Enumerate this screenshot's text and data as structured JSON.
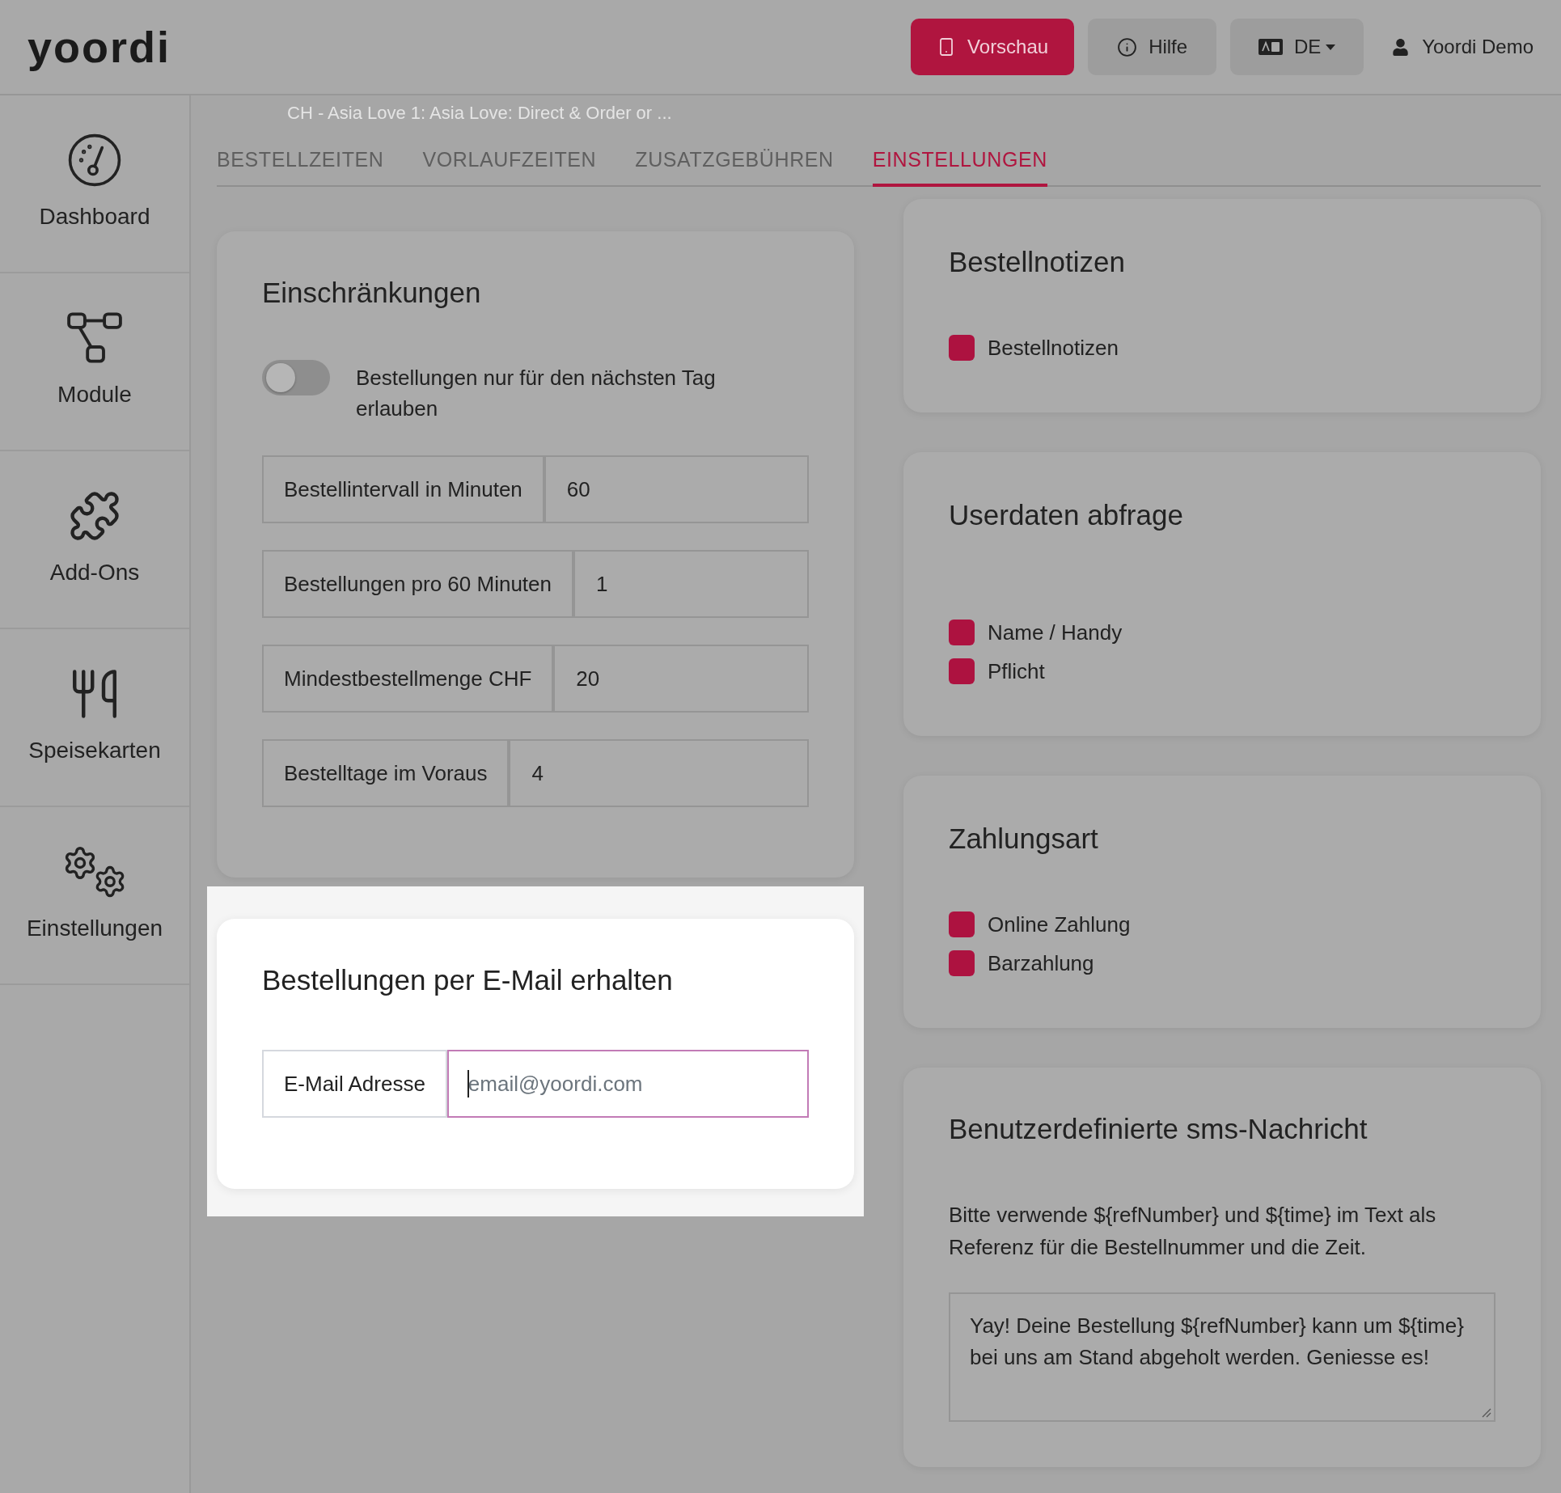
{
  "header": {
    "logo": "yoordi",
    "buttons": [
      {
        "kind": "preview",
        "label": "Vorschau"
      },
      {
        "kind": "help",
        "label": "Hilfe"
      },
      {
        "kind": "language",
        "label": "DE"
      }
    ],
    "user": "Yoordi Demo"
  },
  "sidebar": {
    "items": [
      {
        "kind": "dashboard",
        "label": "Dashboard"
      },
      {
        "kind": "modules",
        "label": "Module"
      },
      {
        "kind": "addons",
        "label": "Add-Ons"
      },
      {
        "kind": "menus",
        "label": "Speisekarten"
      },
      {
        "kind": "settings",
        "label": "Einstellungen"
      }
    ]
  },
  "page_subtitle": "CH - Asia Love 1: Asia Love: Direct & Order or ...",
  "tabs": [
    {
      "label": "BESTELLZEITEN",
      "selected": false
    },
    {
      "label": "VORLAUFZEITEN",
      "selected": false
    },
    {
      "label": "ZUSATZGEBÜHREN",
      "selected": false
    },
    {
      "label": "EINSTELLUNGEN",
      "selected": true
    }
  ],
  "restrictions_card": {
    "title": "Einschränkungen",
    "toggle": {
      "label": "Bestellungen nur für den nächsten Tag erlauben",
      "on": false
    },
    "fields": [
      {
        "label": "Bestellintervall in Minuten",
        "value": "60"
      },
      {
        "label": "Bestellungen pro 60 Minuten",
        "value": "1"
      },
      {
        "label": "Mindestbestellmenge CHF",
        "value": "20"
      },
      {
        "label": "Bestelltage im Voraus",
        "value": "4"
      }
    ]
  },
  "email_card": {
    "title": "Bestellungen per E-Mail erhalten",
    "spotlight": true,
    "field": {
      "label": "E-Mail Adresse",
      "placeholder": "email@yoordi.com",
      "focused": true
    }
  },
  "option_cards": [
    {
      "title": "Bestellnotizen",
      "options": [
        {
          "label": "Bestellnotizen",
          "checked": true
        }
      ]
    },
    {
      "title": "Userdaten abfrage",
      "options": [
        {
          "label": "Name / Handy",
          "checked": true
        },
        {
          "label": "Pflicht",
          "checked": true
        }
      ]
    },
    {
      "title": "Zahlungsart",
      "options": [
        {
          "label": "Online Zahlung",
          "checked": true
        },
        {
          "label": "Barzahlung",
          "checked": true
        }
      ]
    }
  ],
  "sms_card": {
    "title": "Benutzerdefinierte sms-Nachricht",
    "hint": "Bitte verwende ${refNumber} und ${time} im Text als Referenz für die Bestellnummer und die Zeit.",
    "message": "Yay! Deine Bestellung ${refNumber} kann um ${time} bei uns am Stand abgeholt werden. Geniesse es!"
  }
}
